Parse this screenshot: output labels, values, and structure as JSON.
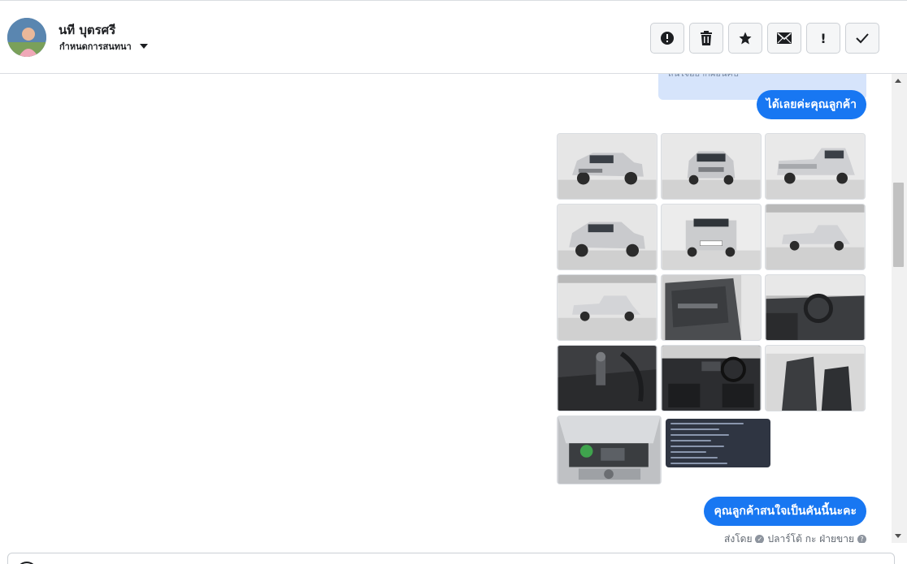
{
  "header": {
    "contact_name": "นที บุตรศรี",
    "assign_label": "กำหนดการสนทนา",
    "toolbar": [
      {
        "name": "report-button",
        "icon": "alert-circle-icon"
      },
      {
        "name": "delete-button",
        "icon": "trash-icon"
      },
      {
        "name": "star-button",
        "icon": "star-icon"
      },
      {
        "name": "mark-unread-button",
        "icon": "envelope-icon"
      },
      {
        "name": "follow-up-button",
        "icon": "exclamation-icon",
        "text": "!"
      },
      {
        "name": "mark-done-button",
        "icon": "check-icon"
      }
    ]
  },
  "messages": {
    "previous_card_text": "สนใจอยากผ่อนคับ",
    "bubble_1": "ได้เลยค่ะคุณลูกค้า",
    "bubble_2": "คุณลูกค้าสนใจเป็นคันนี้นะคะ",
    "sender_prefix": "ส่งโดย",
    "sender_name": "ปลาร์โต้ กะ ฝ่ายขาย",
    "photos": [
      {
        "id": 1,
        "kind": "front-left"
      },
      {
        "id": 2,
        "kind": "front"
      },
      {
        "id": 3,
        "kind": "rear-left"
      },
      {
        "id": 4,
        "kind": "front-left"
      },
      {
        "id": 5,
        "kind": "rear"
      },
      {
        "id": 6,
        "kind": "side"
      },
      {
        "id": 7,
        "kind": "side"
      },
      {
        "id": 8,
        "kind": "door-interior"
      },
      {
        "id": 9,
        "kind": "dashboard"
      },
      {
        "id": 10,
        "kind": "gear-console"
      },
      {
        "id": 11,
        "kind": "dashboard"
      },
      {
        "id": 12,
        "kind": "seats"
      },
      {
        "id": 13,
        "kind": "engine"
      },
      {
        "id": 14,
        "kind": "spec-card"
      }
    ]
  },
  "colors": {
    "accent": "#1877f2",
    "card_bg": "#d6e4fb",
    "toolbar_bg": "#f5f6f7"
  }
}
